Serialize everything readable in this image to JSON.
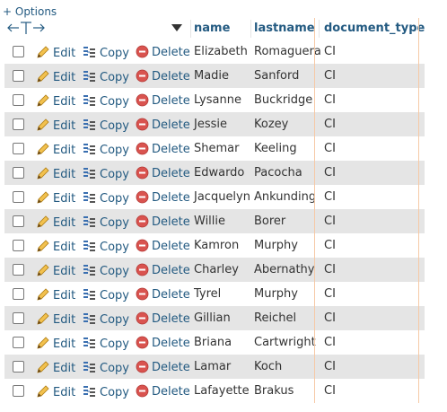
{
  "options_label": "+ Options",
  "columns": {
    "name": "name",
    "lastname": "lastname",
    "document_type": "document_type"
  },
  "actions": {
    "edit": "Edit",
    "copy": "Copy",
    "delete": "Delete"
  },
  "rows": [
    {
      "name": "Elizabeth",
      "lastname": "Romaguera",
      "document_type": "CI"
    },
    {
      "name": "Madie",
      "lastname": "Sanford",
      "document_type": "CI"
    },
    {
      "name": "Lysanne",
      "lastname": "Buckridge",
      "document_type": "CI"
    },
    {
      "name": "Jessie",
      "lastname": "Kozey",
      "document_type": "CI"
    },
    {
      "name": "Shemar",
      "lastname": "Keeling",
      "document_type": "CI"
    },
    {
      "name": "Edwardo",
      "lastname": "Pacocha",
      "document_type": "CI"
    },
    {
      "name": "Jacquelyn",
      "lastname": "Ankunding",
      "document_type": "CI"
    },
    {
      "name": "Willie",
      "lastname": "Borer",
      "document_type": "CI"
    },
    {
      "name": "Kamron",
      "lastname": "Murphy",
      "document_type": "CI"
    },
    {
      "name": "Charley",
      "lastname": "Abernathy",
      "document_type": "CI"
    },
    {
      "name": "Tyrel",
      "lastname": "Murphy",
      "document_type": "CI"
    },
    {
      "name": "Gillian",
      "lastname": "Reichel",
      "document_type": "CI"
    },
    {
      "name": "Briana",
      "lastname": "Cartwright",
      "document_type": "CI"
    },
    {
      "name": "Lamar",
      "lastname": "Koch",
      "document_type": "CI"
    },
    {
      "name": "Lafayette",
      "lastname": "Brakus",
      "document_type": "CI"
    }
  ],
  "icons": {
    "edit": "pencil-icon",
    "copy": "copy-icon",
    "delete": "delete-icon",
    "resize": "column-resize-arrows-icon",
    "sort": "sort-caret-icon"
  },
  "colors": {
    "link": "#235a81",
    "row_alt": "#e5e5e5",
    "highlight_border": "#f6c9a5",
    "delete_icon": "#d9534f",
    "pencil": "#e8a71c"
  }
}
